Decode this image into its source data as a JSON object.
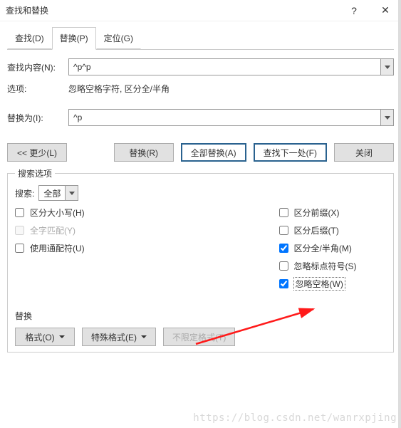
{
  "titlebar": {
    "title": "查找和替换",
    "help": "?",
    "close": "✕"
  },
  "tabs": {
    "find": "查找(D)",
    "replace": "替换(P)",
    "goto": "定位(G)"
  },
  "fields": {
    "find_label": "查找内容(N):",
    "find_value": "^p^p",
    "options_label": "选项:",
    "options_text": "忽略空格字符, 区分全/半角",
    "replace_label": "替换为(I):",
    "replace_value": "^p"
  },
  "buttons": {
    "less": "<< 更少(L)",
    "replace": "替换(R)",
    "replace_all": "全部替换(A)",
    "find_next": "查找下一处(F)",
    "close": "关闭"
  },
  "search_opts": {
    "legend": "搜索选项",
    "search_label": "搜索:",
    "search_value": "全部",
    "match_case": "区分大小写(H)",
    "whole_word": "全字匹配(Y)",
    "use_wildcards": "使用通配符(U)",
    "match_prefix": "区分前缀(X)",
    "match_suffix": "区分后缀(T)",
    "match_width": "区分全/半角(M)",
    "ignore_punct": "忽略标点符号(S)",
    "ignore_space": "忽略空格(W)"
  },
  "replace_sec": {
    "label": "替换",
    "format": "格式(O)",
    "special": "特殊格式(E)",
    "noformat": "不限定格式(T)"
  },
  "watermark": "https://blog.csdn.net/wanrxpjing"
}
